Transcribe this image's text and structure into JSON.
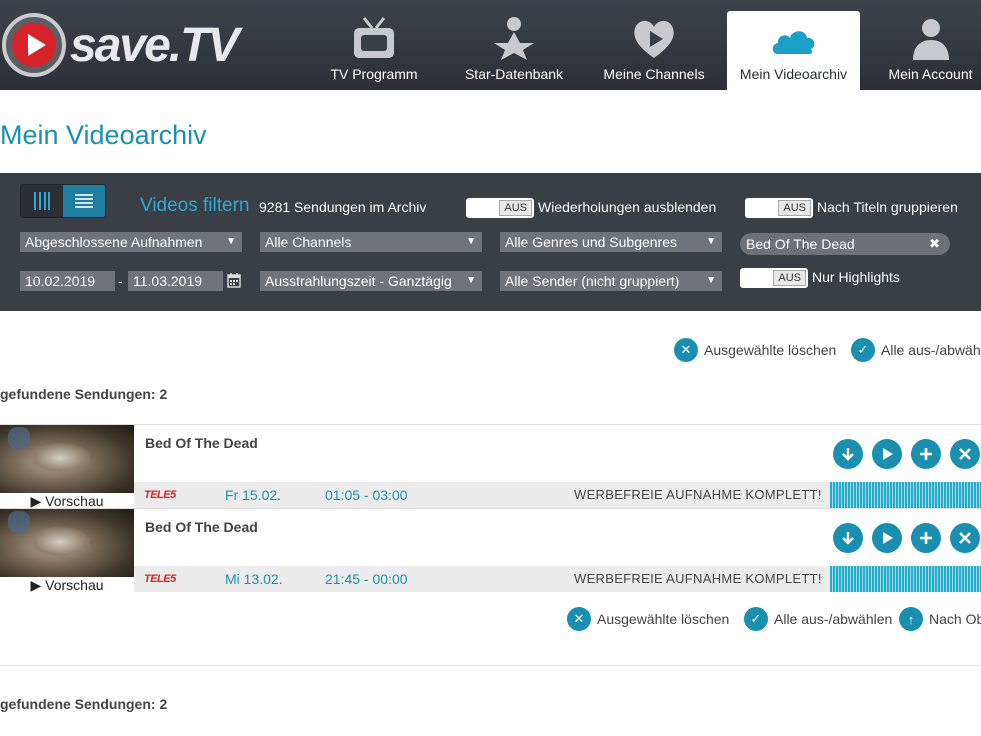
{
  "brand": {
    "name": "save.TV",
    "accent": "#1b8fb0",
    "logo_red": "#d8222b"
  },
  "nav": [
    {
      "label": "TV Programm",
      "icon": "tv-icon",
      "active": false
    },
    {
      "label": "Star-Datenbank",
      "icon": "star-person-icon",
      "active": false
    },
    {
      "label": "Meine Channels",
      "icon": "heart-play-icon",
      "active": false
    },
    {
      "label": "Mein Videoarchiv",
      "icon": "cloud-icon",
      "active": true
    },
    {
      "label": "Mein Account",
      "icon": "user-icon",
      "active": false
    }
  ],
  "page_title": "Mein Videoarchiv",
  "filter": {
    "title": "Videos filtern",
    "count_text": "9281 Sendungen im Archiv",
    "toggle_state": "AUS",
    "toggles": {
      "repeats": "Wiederholungen ausblenden",
      "group": "Nach Titeln gruppieren",
      "highlights": "Nur Highlights"
    },
    "selects": {
      "recordings": "Abgeschlossene Aufnahmen",
      "channels": "Alle Channels",
      "genres": "Alle Genres und Subgenres",
      "airtime": "Ausstrahlungszeit - Ganztägig",
      "sender": "Alle Sender (nicht gruppiert)"
    },
    "search_value": "Bed Of The Dead",
    "date_from": "10.02.2019",
    "date_sep": "-",
    "date_to": "11.03.2019"
  },
  "actions": {
    "delete_selected": "Ausgewählte löschen",
    "select_all_top": "Alle aus-/abwäh",
    "select_all": "Alle aus-/abwählen",
    "scroll_top": "Nach Ob"
  },
  "found_text": "gefundene Sendungen: 2",
  "rows": [
    {
      "title": "Bed Of The Dead",
      "preview": "▶ Vorschau",
      "channel": "TELE5",
      "day": "Fr 15.02.",
      "time": "01:05 - 03:00",
      "status": "WERBEFREIE AUFNAHME KOMPLETT!"
    },
    {
      "title": "Bed Of The Dead",
      "preview": "▶ Vorschau",
      "channel": "TELE5",
      "day": "Mi 13.02.",
      "time": "21:45 - 00:00",
      "status": "WERBEFREIE AUFNAHME KOMPLETT!"
    }
  ]
}
